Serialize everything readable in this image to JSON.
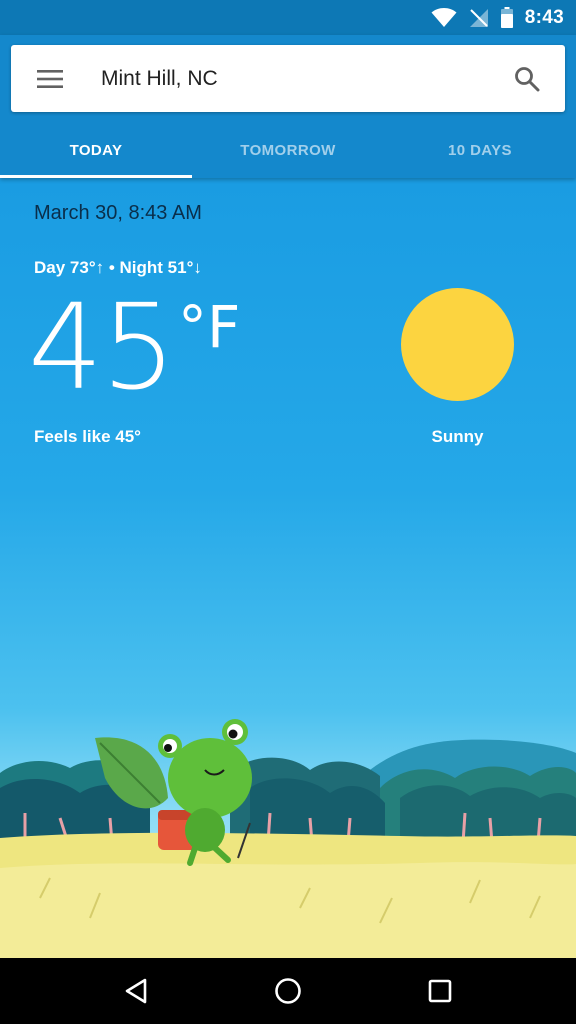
{
  "status_bar": {
    "time": "8:43",
    "icons": [
      "wifi-icon",
      "no-signal-icon",
      "battery-icon"
    ]
  },
  "search": {
    "location": "Mint Hill, NC",
    "menu_icon": "menu-icon",
    "search_icon": "search-icon"
  },
  "tabs": [
    {
      "label": "TODAY",
      "active": true
    },
    {
      "label": "TOMORROW",
      "active": false
    },
    {
      "label": "10 DAYS",
      "active": false
    }
  ],
  "weather": {
    "date_time": "March 30, 8:43 AM",
    "hi_lo": "Day 73°↑ • Night 51°↓",
    "temperature": "45",
    "unit": "°F",
    "feels_like": "Feels like 45°",
    "condition": "Sunny",
    "condition_icon": "sun-icon"
  },
  "illustration": "frog-hiker-illustration",
  "nav_bar": {
    "icons": [
      "back-icon",
      "home-icon",
      "recents-icon"
    ]
  },
  "colors": {
    "status_bar": "#0d78b5",
    "header": "#1488cc",
    "sky_top": "#1a9ce2",
    "sun": "#fcd440",
    "grass": "#f0ea88"
  }
}
